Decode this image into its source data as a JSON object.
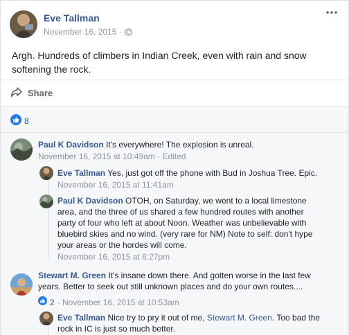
{
  "post": {
    "author": "Eve Tallman",
    "date": "November 16, 2015",
    "separator": "·",
    "text": "Argh. Hundreds of climbers in Indian Creek, even with rain and snow softening the rock.",
    "more_icon": "ellipsis-icon",
    "privacy_icon": "globe-icon"
  },
  "actions": {
    "share_label": "Share"
  },
  "reactions": {
    "count": "8"
  },
  "comments": [
    {
      "author": "Paul K Davidson",
      "text": "It's everywhere! The explosion is unreal.",
      "meta": "November 16, 2015 at 10:49am · Edited",
      "replies": [
        {
          "author": "Eve Tallman",
          "text": "Yes, just got off the phone with Bud in Joshua Tree. Epic.",
          "meta": "November 16, 2015 at 11:41am"
        },
        {
          "author": "Paul K Davidson",
          "text_lines": [
            "OTOH, on Saturday, we went to a local limestone",
            "area, and the three of us shared a few hundred routes with another",
            "party of four who left at about Noon. Weather was unbelievable with",
            "bluebird skies and no wind. (very rare for NM) Note to self: don't hype",
            "your areas or the hordes will come."
          ],
          "meta": "November 16, 2015 at 6:27pm"
        }
      ]
    },
    {
      "author": "Stewart M. Green",
      "text_lines": [
        "It's insane down there. And gotten worse in the last few",
        "years. Better to seek out still unknown places and do your own routes...."
      ],
      "likes": "2",
      "meta": "· November 16, 2015 at 10:53am",
      "replies": [
        {
          "author": "Eve Tallman",
          "text_before": "Nice try to pry it out of me, ",
          "mention": "Stewart M. Green",
          "text_after": ". Too bad the",
          "text_line2": "rock in IC is just so much better."
        }
      ]
    }
  ]
}
